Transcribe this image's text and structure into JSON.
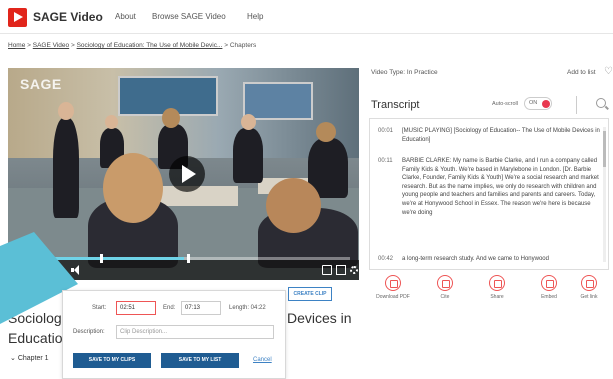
{
  "header": {
    "logo_text": "SAGE Video",
    "nav": {
      "about": "About",
      "browse": "Browse SAGE Video",
      "help": "Help"
    }
  },
  "breadcrumb": {
    "home": "Home",
    "sep": ">",
    "sage_video": "SAGE Video",
    "title": "Sociology of Education: The Use of Mobile Devic...",
    "current": "Chapters"
  },
  "video": {
    "watermark": "SAGE",
    "progress_fraction": 0.48,
    "clip_start_fraction": 0.22,
    "clip_end_fraction": 0.49
  },
  "sidebar": {
    "video_type": "Video Type: In Practice",
    "add_to_list": "Add to list",
    "transcript_title": "Transcript",
    "autoscroll_label": "Auto-scroll",
    "autoscroll_state": "ON",
    "transcript": [
      {
        "time": "00:01",
        "text": "[MUSIC PLAYING] [Sociology of Education-- The Use of Mobile Devices in Education]"
      },
      {
        "time": "00:11",
        "text": "BARBIE CLARKE: My name is Barbie Clarke, and I run a company called Family Kids & Youth. We're based in Marylebone in London. [Dr. Barbie Clarke, Founder, Family Kids & Youth] We're a social research and market research. But as the name implies, we only do research with children and young people and teachers and families and parents and careers. Today, we're at Honywood School in Essex. The reason we're here is because we're doing"
      },
      {
        "time": "00:42",
        "text": "a long-term research study. And we came to Honywood"
      }
    ],
    "tools": [
      {
        "label": "Download PDF"
      },
      {
        "label": "Cite"
      },
      {
        "label": "Share"
      },
      {
        "label": "Embed"
      },
      {
        "label": "Get link"
      }
    ]
  },
  "clip": {
    "create_clip_label": "CREATE CLIP",
    "start_label": "Start:",
    "start_value": "02:51",
    "end_label": "End:",
    "end_value": "07:13",
    "length_label": "Length: 04:22",
    "description_label": "Description:",
    "description_placeholder": "Clip Description...",
    "save_clips_label": "SAVE TO MY CLIPS",
    "save_list_label": "SAVE TO MY LIST",
    "cancel_label": "Cancel"
  },
  "page": {
    "title_line1_visible": "Sociolog",
    "title_line2_visible": "Educatio",
    "title_right_visible": "Devices in",
    "chapter_link": "Chapter 1"
  },
  "colors": {
    "brand_red": "#e1251b",
    "accent_teal": "#5bbfd6",
    "button_blue": "#1f5c92"
  }
}
